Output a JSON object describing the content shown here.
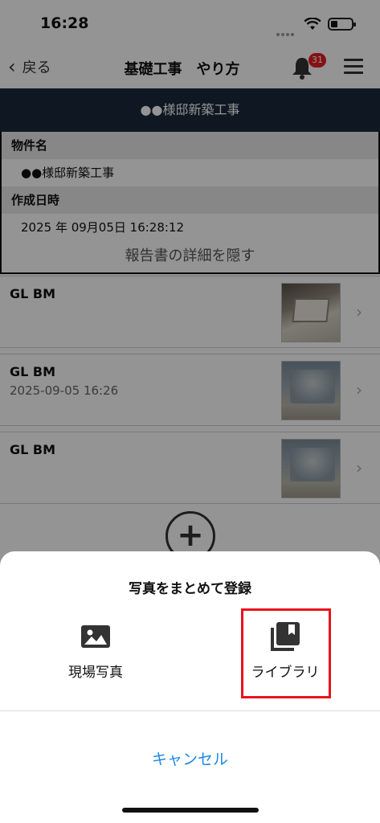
{
  "status_bar": {
    "time": "16:28"
  },
  "nav": {
    "back_label": "戻る",
    "title": "基礎工事　やり方",
    "notification_count": "31"
  },
  "project": {
    "header": "●●様邸新築工事",
    "fields": [
      {
        "label": "物件名",
        "value": "●●様邸新築工事"
      },
      {
        "label": "作成日時",
        "value": "2025 年 09月05日 16:28:12"
      }
    ],
    "toggle_details_label": "報告書の詳細を隠す"
  },
  "photo_items": [
    {
      "title": "GL BM",
      "subtitle": ""
    },
    {
      "title": "GL BM",
      "subtitle": "2025-09-05 16:26"
    },
    {
      "title": "GL BM",
      "subtitle": ""
    }
  ],
  "sheet": {
    "title": "写真をまとめて登録",
    "options": [
      {
        "label": "現場写真",
        "icon": "image-icon"
      },
      {
        "label": "ライブラリ",
        "icon": "photo-library-icon"
      }
    ],
    "cancel_label": "キャンセル"
  },
  "colors": {
    "header_bg": "#1a2a3c",
    "badge": "#e31e24",
    "highlight_border": "#e8141b",
    "cancel_text": "#1e88e5"
  }
}
